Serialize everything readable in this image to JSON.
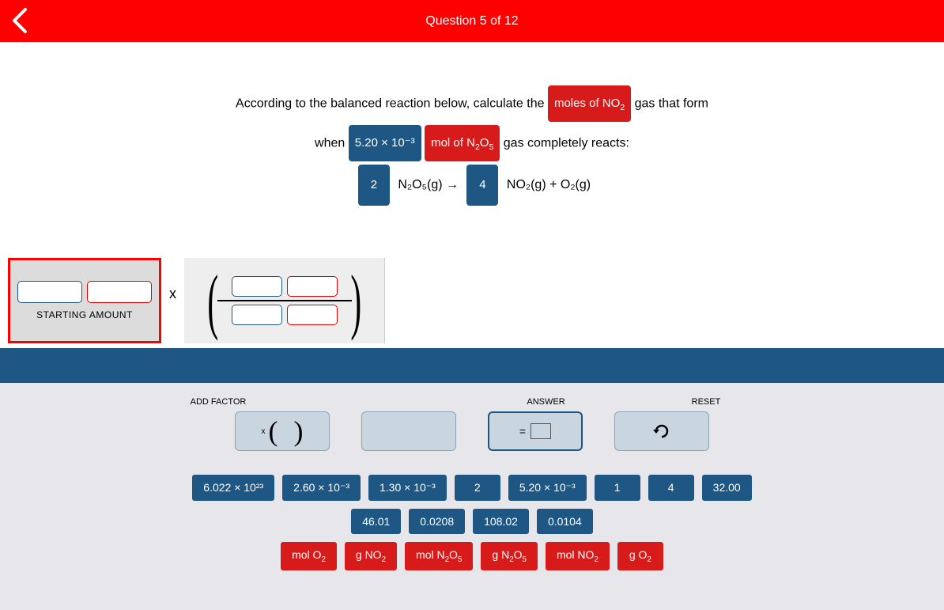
{
  "header": {
    "title": "Question 5 of 12"
  },
  "question": {
    "line1_a": "According to the balanced reaction below, calculate the",
    "chip_moles": "moles of NO",
    "chip_moles_sub": "2",
    "line1_b": "gas that form",
    "line2_a": "when",
    "chip_amount": "5.20 × 10⁻³",
    "chip_mol_of": "mol of N",
    "chip_mol_of_sub1": "2",
    "chip_mol_of_mid": "O",
    "chip_mol_of_sub2": "5",
    "line2_b": "gas completely reacts:",
    "coef1": "2",
    "eq_a": "N₂O₅(g) →",
    "coef2": "4",
    "eq_b": "NO₂(g) + O₂(g)"
  },
  "starting_label": "STARTING AMOUNT",
  "times_symbol": "x",
  "controls": {
    "add_factor": "ADD FACTOR",
    "answer": "ANSWER",
    "reset": "RESET",
    "x": "x",
    "lp": "(",
    "rp": ")",
    "eq": "="
  },
  "tiles_numbers": [
    "6.022 × 10²³",
    "2.60 × 10⁻³",
    "1.30 × 10⁻³",
    "2",
    "5.20 × 10⁻³",
    "1",
    "4",
    "32.00",
    "46.01",
    "0.0208",
    "108.02",
    "0.0104"
  ],
  "tiles_units": [
    {
      "t": "mol O",
      "s": "2"
    },
    {
      "t": "g NO",
      "s": "2"
    },
    {
      "t": "mol N",
      "s": "2",
      "t2": "O",
      "s2": "5"
    },
    {
      "t": "g N",
      "s": "2",
      "t2": "O",
      "s2": "5"
    },
    {
      "t": "mol NO",
      "s": "2"
    },
    {
      "t": "g O",
      "s": "2"
    }
  ]
}
